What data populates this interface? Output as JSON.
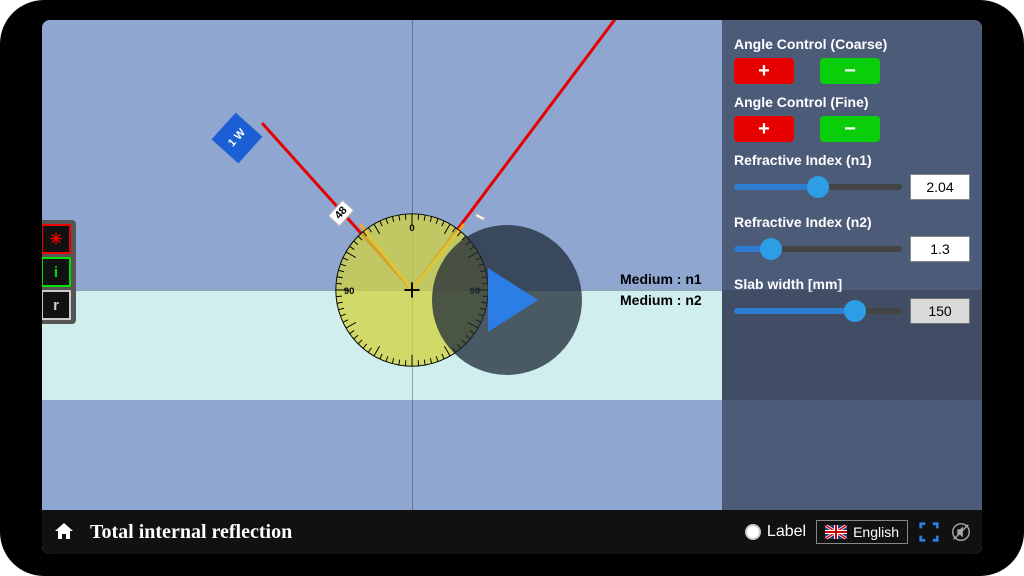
{
  "title": "Total internal reflection",
  "laser_label": "1 W",
  "incident_angle": "48",
  "refract_angle": "",
  "medium1_label": "Medium : n1",
  "medium2_label": "Medium : n2",
  "tools": {
    "laser_icon": "✳",
    "i_label": "i",
    "r_label": "r"
  },
  "panel": {
    "coarse_label": "Angle Control (Coarse)",
    "fine_label": "Angle Control (Fine)",
    "plus": "+",
    "minus": "−",
    "n1_label": "Refractive Index (n1)",
    "n1_value": "2.04",
    "n2_label": "Refractive Index (n2)",
    "n2_value": "1.3",
    "slab_label": "Slab width [mm]",
    "slab_value": "150"
  },
  "bottom": {
    "label_toggle": "Label",
    "language": "English"
  },
  "sliders": {
    "n1_pct": 50,
    "n2_pct": 22,
    "slab_pct": 72
  }
}
